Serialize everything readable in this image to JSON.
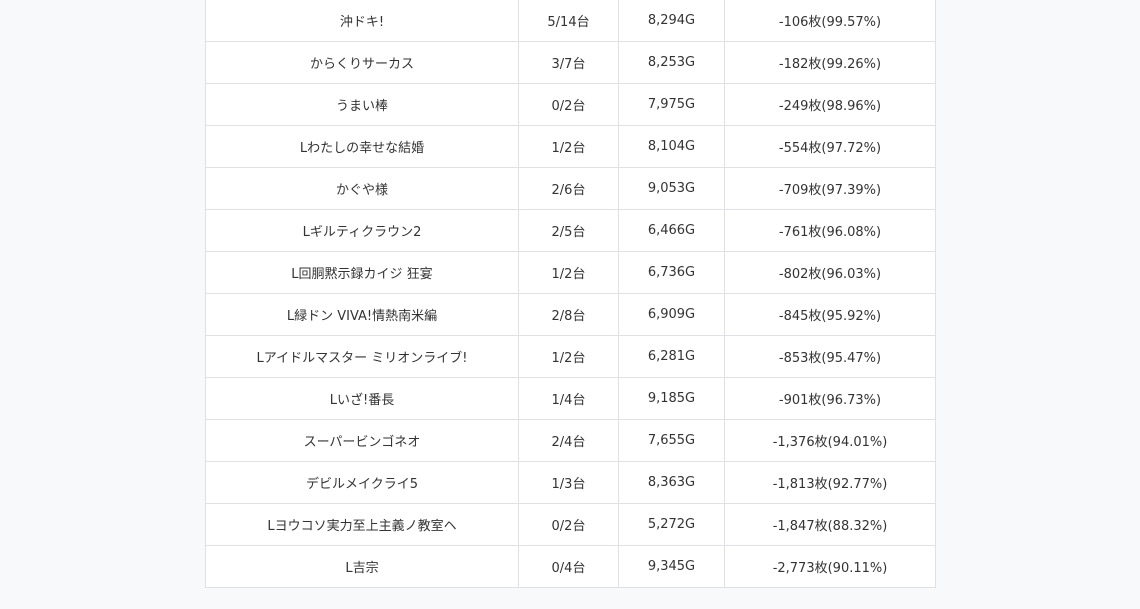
{
  "rows": [
    {
      "machine": "沖ドキ!",
      "units": "5/14台",
      "games": "8,294G",
      "result": "-106枚(99.57%)"
    },
    {
      "machine": "からくりサーカス",
      "units": "3/7台",
      "games": "8,253G",
      "result": "-182枚(99.26%)"
    },
    {
      "machine": "うまい棒",
      "units": "0/2台",
      "games": "7,975G",
      "result": "-249枚(98.96%)"
    },
    {
      "machine": "Lわたしの幸せな結婚",
      "units": "1/2台",
      "games": "8,104G",
      "result": "-554枚(97.72%)"
    },
    {
      "machine": "かぐや様",
      "units": "2/6台",
      "games": "9,053G",
      "result": "-709枚(97.39%)"
    },
    {
      "machine": "Lギルティクラウン2",
      "units": "2/5台",
      "games": "6,466G",
      "result": "-761枚(96.08%)"
    },
    {
      "machine": "L回胴黙示録カイジ 狂宴",
      "units": "1/2台",
      "games": "6,736G",
      "result": "-802枚(96.03%)"
    },
    {
      "machine": "L緑ドン VIVA!情熱南米編",
      "units": "2/8台",
      "games": "6,909G",
      "result": "-845枚(95.92%)"
    },
    {
      "machine": "Lアイドルマスター ミリオンライブ!",
      "units": "1/2台",
      "games": "6,281G",
      "result": "-853枚(95.47%)"
    },
    {
      "machine": "Lいざ!番長",
      "units": "1/4台",
      "games": "9,185G",
      "result": "-901枚(96.73%)"
    },
    {
      "machine": "スーパービンゴネオ",
      "units": "2/4台",
      "games": "7,655G",
      "result": "-1,376枚(94.01%)"
    },
    {
      "machine": "デビルメイクライ5",
      "units": "1/3台",
      "games": "8,363G",
      "result": "-1,813枚(92.77%)"
    },
    {
      "machine": "Lヨウコソ実力至上主義ノ教室ヘ",
      "units": "0/2台",
      "games": "5,272G",
      "result": "-1,847枚(88.32%)"
    },
    {
      "machine": "L吉宗",
      "units": "0/4台",
      "games": "9,345G",
      "result": "-2,773枚(90.11%)"
    }
  ]
}
